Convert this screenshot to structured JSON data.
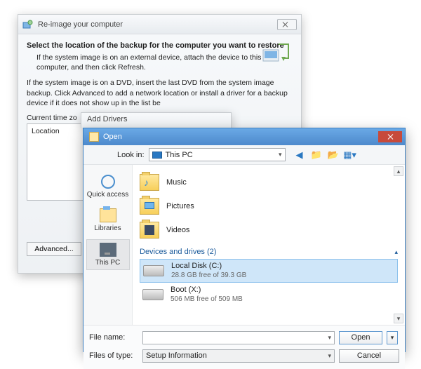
{
  "reimage": {
    "title": "Re-image your computer",
    "heading": "Select the location of the backup for the computer you want to restore",
    "para1": "If the system image is on an external device, attach the device to this computer, and then click Refresh.",
    "para2": "If the system image is on a DVD, insert the last DVD from the system image backup. Click Advanced to add a network location or install a driver for a backup device if it does not show up in the list be",
    "tz_label": "Current time zo",
    "grid_header": "Location",
    "advanced_btn": "Advanced..."
  },
  "mid": {
    "title": "Add Drivers"
  },
  "open": {
    "title": "Open",
    "lookin_label": "Look in:",
    "lookin_value": "This PC",
    "places": {
      "quick": "Quick access",
      "libraries": "Libraries",
      "thispc": "This PC"
    },
    "folders": {
      "music": "Music",
      "pictures": "Pictures",
      "videos": "Videos"
    },
    "section": "Devices and drives (2)",
    "drives": [
      {
        "name": "Local Disk (C:)",
        "sub": "28.8 GB free of 39.3 GB"
      },
      {
        "name": "Boot (X:)",
        "sub": "506 MB free of 509 MB"
      }
    ],
    "filename_label": "File name:",
    "filename_value": "",
    "filetype_label": "Files of type:",
    "filetype_value": "Setup Information",
    "open_btn": "Open",
    "cancel_btn": "Cancel"
  }
}
